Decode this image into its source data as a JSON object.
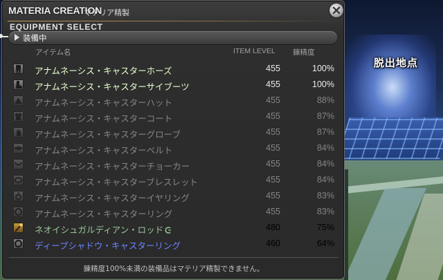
{
  "scene": {
    "place_label": "脱出地点"
  },
  "window": {
    "title_main": "MATERIA CREATION",
    "title_sub": "マテリア精製",
    "section_title": "EQUIPMENT SELECT",
    "category": "装備中",
    "columns": {
      "name": "アイテム名",
      "item_level": "ITEM LEVEL",
      "spiritbond": "錬精度"
    },
    "rows": [
      {
        "icon": "leggings-icon",
        "name": "アナムネーシス・キャスターホーズ",
        "ilvl": "455",
        "spirit": "100%",
        "state": "enabled"
      },
      {
        "icon": "boots-icon",
        "name": "アナムネーシス・キャスターサイブーツ",
        "ilvl": "455",
        "spirit": "100%",
        "state": "enabled"
      },
      {
        "icon": "hat-icon",
        "name": "アナムネーシス・キャスターハット",
        "ilvl": "455",
        "spirit": "88%",
        "state": "disabled"
      },
      {
        "icon": "coat-icon",
        "name": "アナムネーシス・キャスターコート",
        "ilvl": "455",
        "spirit": "87%",
        "state": "disabled"
      },
      {
        "icon": "gloves-icon",
        "name": "アナムネーシス・キャスターグローブ",
        "ilvl": "455",
        "spirit": "87%",
        "state": "disabled"
      },
      {
        "icon": "belt-icon",
        "name": "アナムネーシス・キャスターベルト",
        "ilvl": "455",
        "spirit": "84%",
        "state": "disabled"
      },
      {
        "icon": "choker-icon",
        "name": "アナムネーシス・キャスターチョーカー",
        "ilvl": "455",
        "spirit": "84%",
        "state": "disabled"
      },
      {
        "icon": "bracelet-icon",
        "name": "アナムネーシス・キャスターブレスレット",
        "ilvl": "455",
        "spirit": "84%",
        "state": "disabled"
      },
      {
        "icon": "earring-icon",
        "name": "アナムネーシス・キャスターイヤリング",
        "ilvl": "455",
        "spirit": "83%",
        "state": "disabled"
      },
      {
        "icon": "ring-icon",
        "name": "アナムネーシス・キャスターリング",
        "ilvl": "455",
        "spirit": "83%",
        "state": "disabled"
      },
      {
        "icon": "rod-icon",
        "name": "ネオイシュガルディアン・ロッド",
        "ilvl": "480",
        "spirit": "75%",
        "state": "hq"
      },
      {
        "icon": "ring-icon",
        "name": "ディープシャドウ・キャスターリング",
        "ilvl": "460",
        "spirit": "64%",
        "state": "blue"
      }
    ],
    "footer_note": "錬精度100%未満の装備品はマテリア精製できません。"
  },
  "colors": {
    "enabled_name": "#e8ffcf",
    "disabled_text": "#858585",
    "hq_name": "#9bc79a",
    "rare_name": "#6c84ff",
    "title_accent": "#c8a058"
  }
}
